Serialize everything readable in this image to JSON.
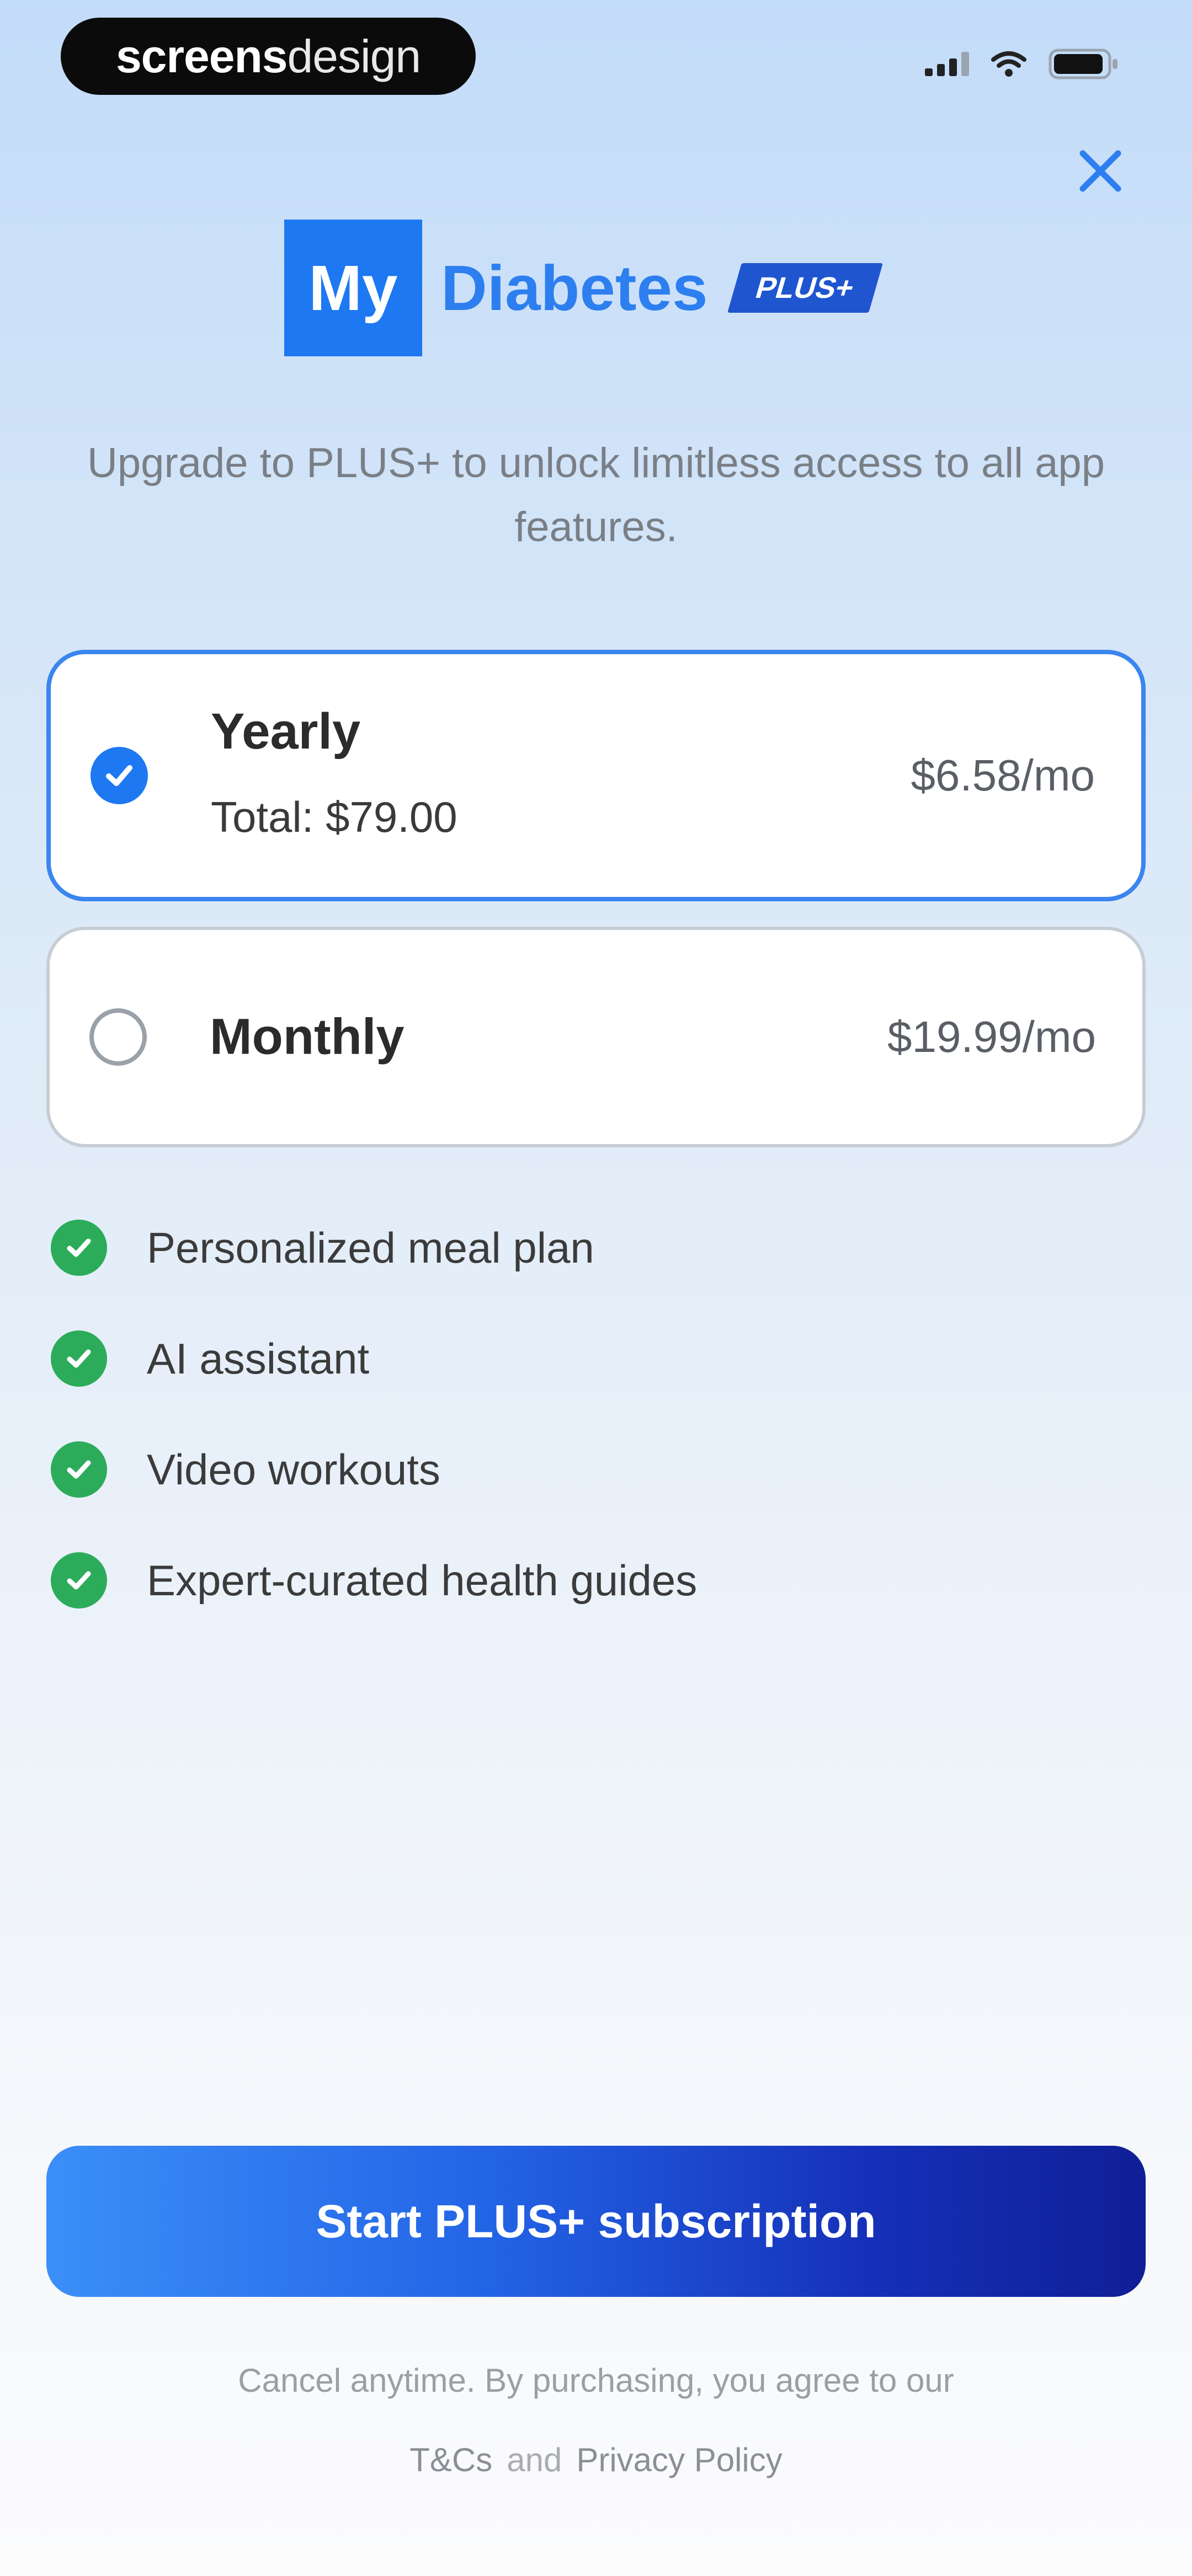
{
  "status_bar": {
    "brand_bold": "screens",
    "brand_light": "design"
  },
  "logo": {
    "box_text": "My",
    "word": "Diabetes",
    "badge": "PLUS+"
  },
  "subtitle": "Upgrade to PLUS+ to unlock limitless access to all app features.",
  "plans": [
    {
      "name": "Yearly",
      "total": "Total: $79.00",
      "price": "$6.58/mo",
      "selected": true
    },
    {
      "name": "Monthly",
      "price": "$19.99/mo",
      "selected": false
    }
  ],
  "features": [
    "Personalized meal plan",
    "AI assistant",
    "Video workouts",
    "Expert-curated health guides"
  ],
  "cta_label": "Start PLUS+ subscription",
  "legal": {
    "text": "Cancel anytime. By purchasing, you agree to our",
    "terms": "T&Cs",
    "and": "and",
    "privacy": "Privacy Policy"
  },
  "colors": {
    "accent": "#1e78f2",
    "check_green": "#2cac5a",
    "cta_start": "#3b8ff8",
    "cta_end": "#0f1f96"
  },
  "icons": [
    "close-icon",
    "check-icon",
    "signal-icon",
    "wifi-icon",
    "battery-icon"
  ]
}
